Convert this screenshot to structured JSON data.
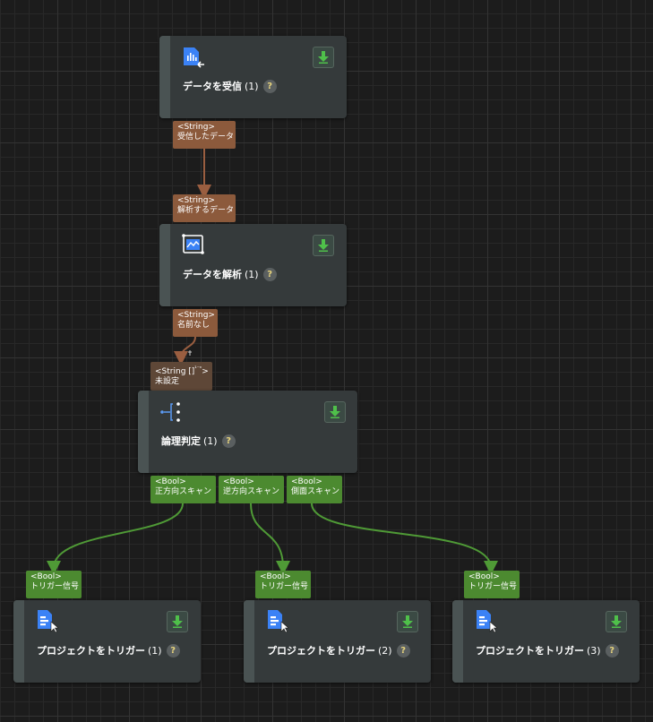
{
  "colors": {
    "background": "#1c1c1c",
    "node": "#353a3b",
    "string_port": "#8c5a3c",
    "bool_port": "#4c8a30",
    "string_wire": "#9a5e40",
    "bool_wire": "#4f9a36",
    "download": "#4fc04a",
    "icon_blue": "#3b82f6"
  },
  "nodes": {
    "receive": {
      "title": "データを受信",
      "num": "(1)",
      "help": "?",
      "icon": "receive-data-icon"
    },
    "parse": {
      "title": "データを解析",
      "num": "(1)",
      "help": "?",
      "icon": "parse-data-icon"
    },
    "logic": {
      "title": "論理判定",
      "num": "(1)",
      "help": "?",
      "icon": "logic-branch-icon"
    },
    "trigger1": {
      "title": "プロジェクトをトリガー",
      "num": "(1)",
      "help": "?",
      "icon": "trigger-project-icon"
    },
    "trigger2": {
      "title": "プロジェクトをトリガー",
      "num": "(2)",
      "help": "?",
      "icon": "trigger-project-icon"
    },
    "trigger3": {
      "title": "プロジェクトをトリガー",
      "num": "(3)",
      "help": "?",
      "icon": "trigger-project-icon"
    }
  },
  "ports": {
    "receive_out": {
      "type": "<String>",
      "name": "受信したデータ"
    },
    "parse_in": {
      "type": "<String>",
      "name": "解析するデータ"
    },
    "parse_out": {
      "type": "<String>",
      "name": "名前なし"
    },
    "logic_in": {
      "type": "<String []",
      "type_suffix": "¹⁻ⁿ",
      "type_close": ">",
      "name": "未設定"
    },
    "logic_out1": {
      "type": "<Bool>",
      "name": "正方向スキャン"
    },
    "logic_out2": {
      "type": "<Bool>",
      "name": "逆方向スキャン"
    },
    "logic_out3": {
      "type": "<Bool>",
      "name": "側面スキャン"
    },
    "trigger1_in": {
      "type": "<Bool>",
      "name": "トリガー信号"
    },
    "trigger2_in": {
      "type": "<Bool>",
      "name": "トリガー信号"
    },
    "trigger3_in": {
      "type": "<Bool>",
      "name": "トリガー信号"
    }
  },
  "edges": [
    {
      "from": "receive_out",
      "to": "parse_in",
      "kind": "string"
    },
    {
      "from": "parse_out",
      "to": "logic_in",
      "kind": "string"
    },
    {
      "from": "logic_out1",
      "to": "trigger1_in",
      "kind": "bool"
    },
    {
      "from": "logic_out2",
      "to": "trigger2_in",
      "kind": "bool"
    },
    {
      "from": "logic_out3",
      "to": "trigger3_in",
      "kind": "bool"
    }
  ]
}
